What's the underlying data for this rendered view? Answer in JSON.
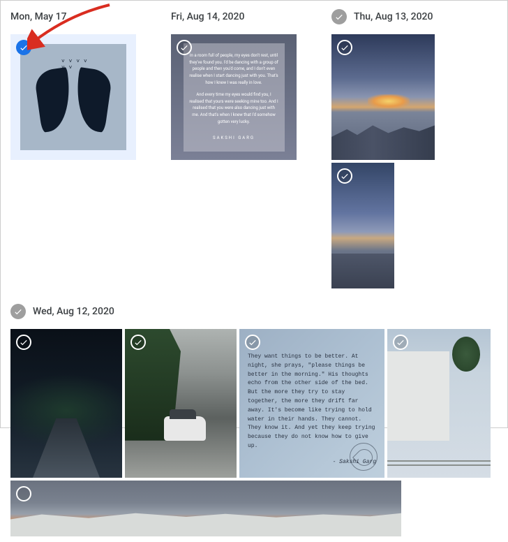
{
  "arrow": {
    "color": "#d92d20"
  },
  "groups": [
    {
      "date": "Mon, May 17",
      "hasHeaderCheck": false,
      "photos": [
        {
          "type": "wings",
          "selected": true
        }
      ]
    },
    {
      "date": "Fri, Aug 14, 2020",
      "hasHeaderCheck": false,
      "photos": [
        {
          "type": "quote1",
          "selected": false,
          "para1": "In a room full of people, my eyes don't rest, until they've found you. I'd be dancing with a group of people and then you'd come, and I don't even realise when I start dancing just with you. That's how I knew I was really in love.",
          "para2": "And every time my eyes would find you, I realised that yours were seeking mine too. And I realised that you were also dancing just with me. And that's when I knew that I'd somehow gotten very lucky.",
          "author": "SAKSHI GARG"
        }
      ]
    },
    {
      "date": "Thu, Aug 13, 2020",
      "hasHeaderCheck": true,
      "photos": [
        {
          "type": "sky1",
          "selected": false,
          "width": 148
        },
        {
          "type": "sky2",
          "selected": false,
          "width": 90
        }
      ]
    }
  ],
  "group2": {
    "date": "Wed, Aug 12, 2020",
    "hasHeaderCheck": true,
    "photos": [
      {
        "type": "dark-trees",
        "selected": false
      },
      {
        "type": "street",
        "selected": false
      },
      {
        "type": "quote2",
        "selected": false,
        "text": "They want things to be better. At night, she prays, \"please things be better in the morning.\" His thoughts echo from the other side of the bed. But the more they try to stay together, the more they drift far away. It's become like trying to hold water in their hands. They cannot. They know it. And yet they keep trying because they do not know how to give up.",
        "author": "- Sakshi Garg"
      },
      {
        "type": "building",
        "selected": false
      }
    ],
    "row3": [
      {
        "type": "wide-sunset",
        "selected": false
      }
    ]
  }
}
